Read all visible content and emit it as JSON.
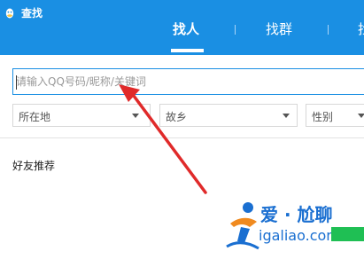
{
  "window": {
    "title": "查找"
  },
  "tabs": [
    {
      "label": "找人"
    },
    {
      "label": "找群"
    },
    {
      "label": "找"
    }
  ],
  "search": {
    "placeholder": "请输入QQ号码/昵称/关键词",
    "value": ""
  },
  "filters": {
    "location": "所在地",
    "hometown": "故乡",
    "gender": "性别"
  },
  "section": {
    "friend_recommend": "好友推荐"
  },
  "watermark": {
    "title": "爱 · 尬聊",
    "url": "igaliao.com"
  },
  "colors": {
    "header": "#1a8fe3",
    "annotation": "#e02a2a",
    "watermark": "#1a6fd1"
  }
}
